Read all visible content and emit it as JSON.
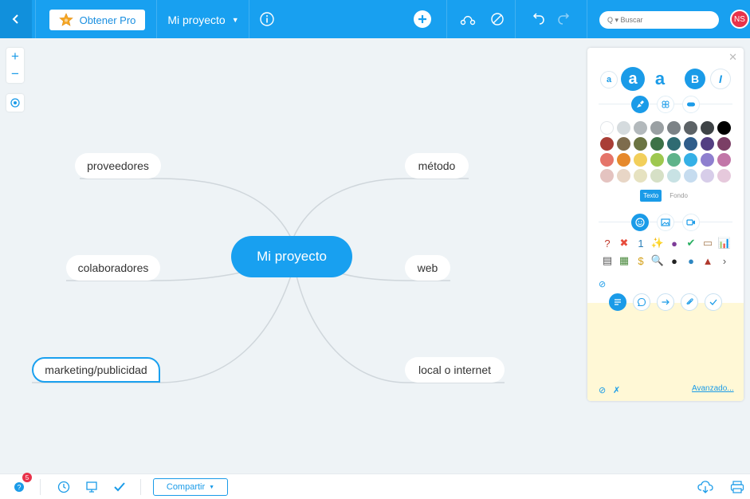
{
  "toolbar": {
    "pro_label": "Obtener Pro",
    "project_name": "Mi proyecto",
    "search_placeholder": "Q ▾ Buscar",
    "user_initials": "NS",
    "accent": "#18a0f0"
  },
  "map": {
    "root": "Mi proyecto",
    "nodes": [
      {
        "id": "proveedores",
        "label": "proveedores"
      },
      {
        "id": "colaboradores",
        "label": "colaboradores"
      },
      {
        "id": "marketing",
        "label": "marketing/publicidad"
      },
      {
        "id": "metodo",
        "label": "método"
      },
      {
        "id": "web",
        "label": "web"
      },
      {
        "id": "local",
        "label": "local o internet"
      }
    ]
  },
  "panel": {
    "font_sizes": [
      "a",
      "a",
      "a"
    ],
    "bold": "B",
    "italic": "I",
    "text_tab": "Texto",
    "bg_tab": "Fondo",
    "advanced": "Avanzado...",
    "colors": [
      "#ffffff",
      "#d5dbde",
      "#b3b9bc",
      "#9aa0a3",
      "#7c8286",
      "#5c6266",
      "#3e4346",
      "#000000",
      "#a93e36",
      "#7e6c4d",
      "#6b7442",
      "#3d7247",
      "#2f6b72",
      "#2f5d8a",
      "#533f82",
      "#7b3f66",
      "#e57469",
      "#e6892c",
      "#f2cf5b",
      "#9ec84f",
      "#5fb38a",
      "#35b0e6",
      "#8e7fcf",
      "#c276a8",
      "#e4c3c0",
      "#e8d6c6",
      "#e6e2c0",
      "#d6e0c6",
      "#c8e2e4",
      "#c6dcef",
      "#d7cde9",
      "#e6c9dc"
    ],
    "icons": [
      "?",
      "✖",
      "1",
      "✨",
      "●",
      "✔",
      "▭",
      "📊",
      "▤",
      "▦",
      "$",
      "🔍",
      "●",
      "●",
      "▲",
      "›"
    ]
  },
  "bottom": {
    "help_badge": "5",
    "share_label": "Compartir"
  }
}
